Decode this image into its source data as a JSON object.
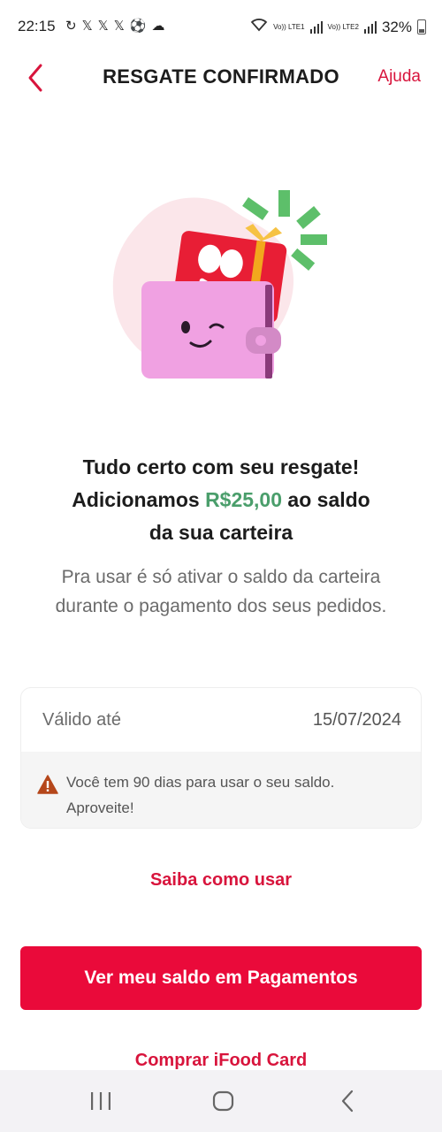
{
  "status_bar": {
    "time": "22:15",
    "notification_icons": [
      "sync-icon",
      "x-icon",
      "x-icon",
      "x-icon",
      "soccer-ball-icon",
      "cloud-icon"
    ],
    "sim1": "Vo)) LTE1",
    "sim2": "Vo)) LTE2",
    "battery": "32%"
  },
  "header": {
    "title": "RESGATE CONFIRMADO",
    "help_label": "Ajuda"
  },
  "confirmation": {
    "headline_line1": "Tudo certo com seu resgate!",
    "headline_prefix": "Adicionamos ",
    "amount": "R$25,00",
    "headline_suffix": " ao saldo",
    "headline_line3": "da sua carteira",
    "description": "Pra usar é só ativar o saldo da carteira durante o pagamento dos seus pedidos."
  },
  "validity": {
    "label": "Válido até",
    "date": "15/07/2024",
    "note_line1": "Você tem 90 dias para usar o seu saldo.",
    "note_line2": "Aproveite!"
  },
  "actions": {
    "learn_how": "Saiba como usar",
    "primary": "Ver meu saldo em Pagamentos",
    "buy_card": "Comprar iFood Card"
  },
  "colors": {
    "brand_red": "#ea0a3a",
    "link_red": "#d8143c",
    "amount_green": "#4a9e6b",
    "warning_brown": "#b5471b"
  }
}
